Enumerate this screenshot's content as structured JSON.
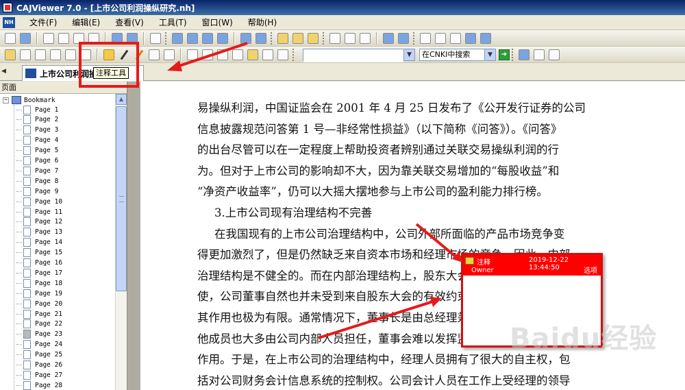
{
  "window": {
    "title": "CAJViewer 7.0 - [上市公司利润操纵研究.nh]"
  },
  "menu": {
    "logo": "NH",
    "items": [
      "文件(F)",
      "编辑(E)",
      "查看(V)",
      "工具(T)",
      "窗口(W)",
      "帮助(H)"
    ]
  },
  "toolbar": {
    "search_placeholder": "",
    "search_scope": "在CNKI中搜索"
  },
  "tabs": [
    {
      "label": "上市公司利润操"
    }
  ],
  "tooltip": {
    "text": "注释工具"
  },
  "sidebar": {
    "header": "页面",
    "root_label": "Bookmark",
    "pages": [
      "Page 1",
      "Page 2",
      "Page 3",
      "Page 4",
      "Page 5",
      "Page 6",
      "Page 7",
      "Page 8",
      "Page 9",
      "Page 10",
      "Page 11",
      "Page 12",
      "Page 13",
      "Page 14",
      "Page 15",
      "Page 16",
      "Page 17",
      "Page 18",
      "Page 19",
      "Page 20",
      "Page 21",
      "Page 22",
      "Page 23",
      "Page 24",
      "Page 25",
      "Page 26",
      "Page 27",
      "Page 28"
    ],
    "selected_page": "Page 23"
  },
  "document": {
    "lines": [
      "易操纵利润，中国证监会在 2001 年 4 月 25 日发布了《公开发行证券的公司",
      "信息披露规范问答第 1 号—非经常性损益》（以下简称《问答》）。《问答》",
      "的出台尽管可以在一定程度上帮助投资者辨别通过关联交易操纵利润的行",
      "为。但对于上市公司的影响却不大，因为靠关联交易增加的“每股收益”和",
      "“净资产收益率”，仍可以大摇大摆地参与上市公司的盈利能力排行榜。",
      "3.上市公司现有治理结构不完善",
      "在我国现有的上市公司治理结构中，公司外部所面临的产品市场竞争变",
      "得更加激烈了，但是仍然缺乏来自资本市场和经理市场的竞争，因此，内部",
      "治理结构是不健全的。而在内部治理结构上，股东大会的权力由董事会行",
      "使，公司董事自然也并未受到来自股东大会的有效约束。即使召开股东大会，",
      "其作用也极为有限。通常情况下，董事长是由总经理兼任的，董事会的其",
      "他成员也大多由公司内部人员担任，董事会难以发挥监督作用，监事会的",
      "作用。于是，在上市公司的治理结构中，经理人员拥有了很大的自主权，包",
      "括对公司财务会计信息系统的控制权。公司会计人员在工作上受经理的领导"
    ]
  },
  "annotation": {
    "title": "注释",
    "timestamp": "2019-12-22 13:44:50",
    "owner": "Owner",
    "options_label": "选项",
    "content": ""
  },
  "watermark": {
    "text": "Baidu经验"
  },
  "colors": {
    "highlight_box": "#e51b1b",
    "note_header": "#ff0000",
    "title_bar": "#0a246a"
  }
}
